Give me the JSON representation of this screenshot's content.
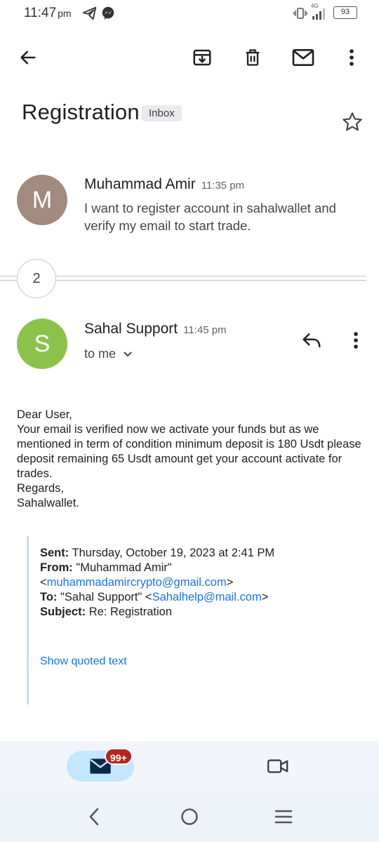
{
  "status": {
    "time": "11:47",
    "ampm": "pm",
    "network": "4G",
    "battery": "93"
  },
  "email": {
    "subject": "Registration",
    "label": "Inbox",
    "thread_count": "2",
    "messages": [
      {
        "avatar_letter": "M",
        "avatar_color": "#a38a7e",
        "sender": "Muhammad Amir",
        "time": "11:35 pm",
        "snippet": "I want to register account in sahalwallet and verify my email to start trade."
      },
      {
        "avatar_letter": "S",
        "avatar_color": "#8bc34a",
        "sender": "Sahal Support",
        "time": "11:45 pm",
        "recipient": "to me",
        "body": [
          "Dear User,",
          "Your email is verified now we activate your funds but as we mentioned in term of condition minimum deposit is 180 Usdt please deposit remaining 65 Usdt amount get your account activate for trades.",
          "Regards,",
          "Sahalwallet."
        ],
        "quoted": {
          "sent_label": "Sent:",
          "sent_value": "Thursday, October 19, 2023 at 2:41 PM",
          "from_label": "From:",
          "from_name": "\"Muhammad Amir\"",
          "from_email": "muhammadamircrypto@gmail.com",
          "to_label": "To:",
          "to_name": "\"Sahal Support\"",
          "to_email": "Sahalhelp@mail.com",
          "subject_label": "Subject:",
          "subject_value": "Re: Registration",
          "show_quoted": "Show quoted text"
        }
      }
    ]
  },
  "bottom_nav": {
    "mail_badge": "99+"
  },
  "colors": {
    "accent": "#1a73e8",
    "badge": "#b3261e",
    "pill": "#c2e7ff"
  }
}
